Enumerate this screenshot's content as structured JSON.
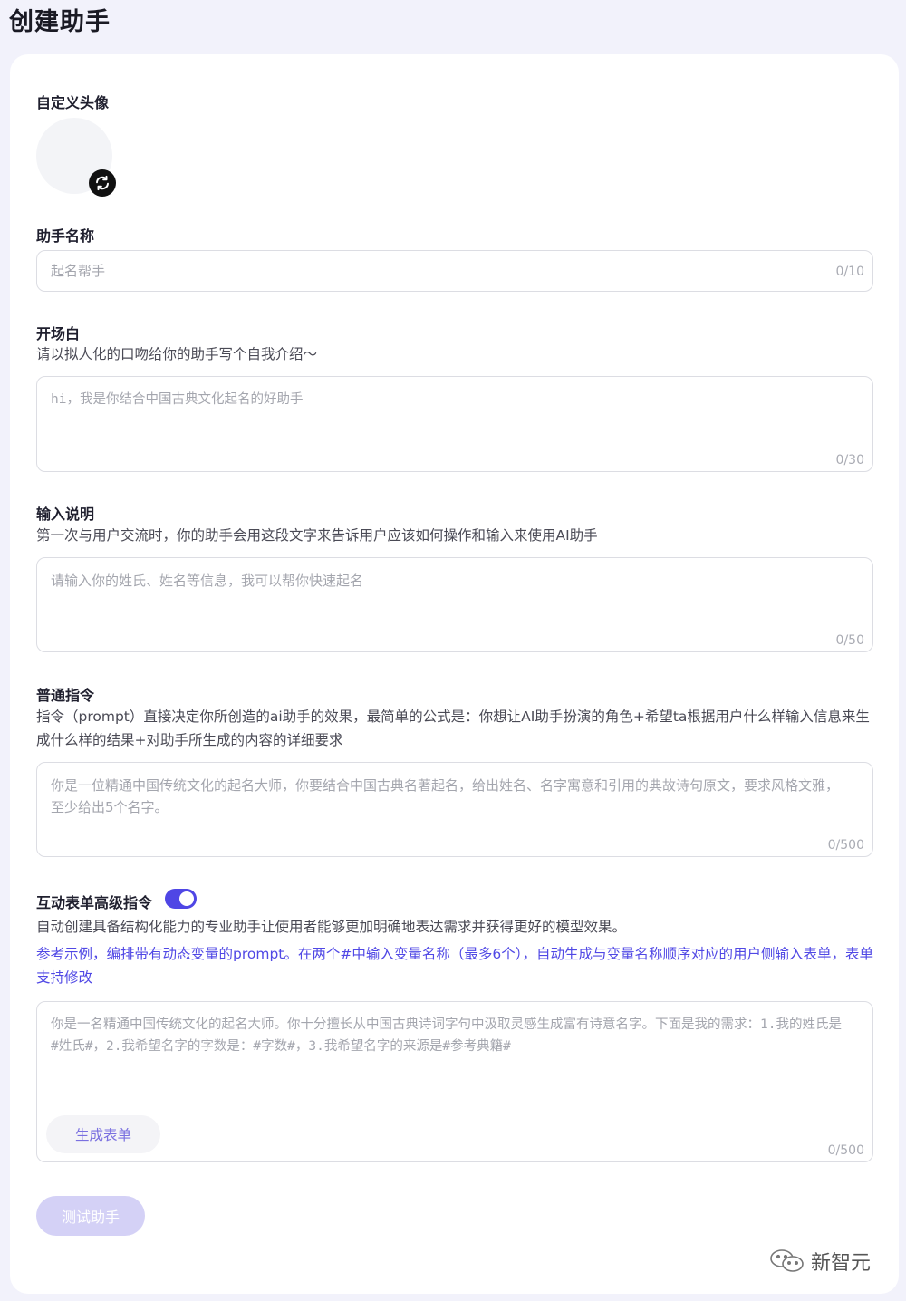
{
  "header": {
    "title": "创建助手"
  },
  "avatar_section": {
    "label": "自定义头像"
  },
  "name_section": {
    "label": "助手名称",
    "placeholder": "起名帮手",
    "counter": "0/10"
  },
  "opening_section": {
    "label": "开场白",
    "description": "请以拟人化的口吻给你的助手写个自我介绍～",
    "placeholder": "hi，我是你结合中国古典文化起名的好助手",
    "counter": "0/30"
  },
  "input_desc_section": {
    "label": "输入说明",
    "description": "第一次与用户交流时，你的助手会用这段文字来告诉用户应该如何操作和输入来使用AI助手",
    "placeholder": "请输入你的姓氏、姓名等信息，我可以帮你快速起名",
    "counter": "0/50"
  },
  "prompt_section": {
    "label": "普通指令",
    "description": "指令（prompt）直接决定你所创造的ai助手的效果，最简单的公式是：你想让AI助手扮演的角色+希望ta根据用户什么样输入信息来生成什么样的结果+对助手所生成的内容的详细要求",
    "placeholder": "你是一位精通中国传统文化的起名大师，你要结合中国古典名著起名，给出姓名、名字寓意和引用的典故诗句原文，要求风格文雅，至少给出5个名字。",
    "counter": "0/500"
  },
  "form_section": {
    "label": "互动表单高级指令",
    "toggle_on": true,
    "description": "自动创建具备结构化能力的专业助手让使用者能够更加明确地表达需求并获得更好的模型效果。",
    "hint": "参考示例，编排带有动态变量的prompt。在两个#中输入变量名称（最多6个），自动生成与变量名称顺序对应的用户侧输入表单，表单支持修改",
    "placeholder": "你是一名精通中国传统文化的起名大师。你十分擅长从中国古典诗词字句中汲取灵感生成富有诗意名字。下面是我的需求：1.我的姓氏是#姓氏#，2.我希望名字的字数是：#字数#，3.我希望名字的来源是#参考典籍#",
    "generate_button": "生成表单",
    "counter": "0/500"
  },
  "footer": {
    "test_button": "测试助手",
    "watermark": "新智元"
  },
  "colors": {
    "accent": "#4f46e5",
    "hint_text": "#5048e5",
    "test_button_bg": "#d4d1f6",
    "page_bg": "#f2f2fb"
  }
}
